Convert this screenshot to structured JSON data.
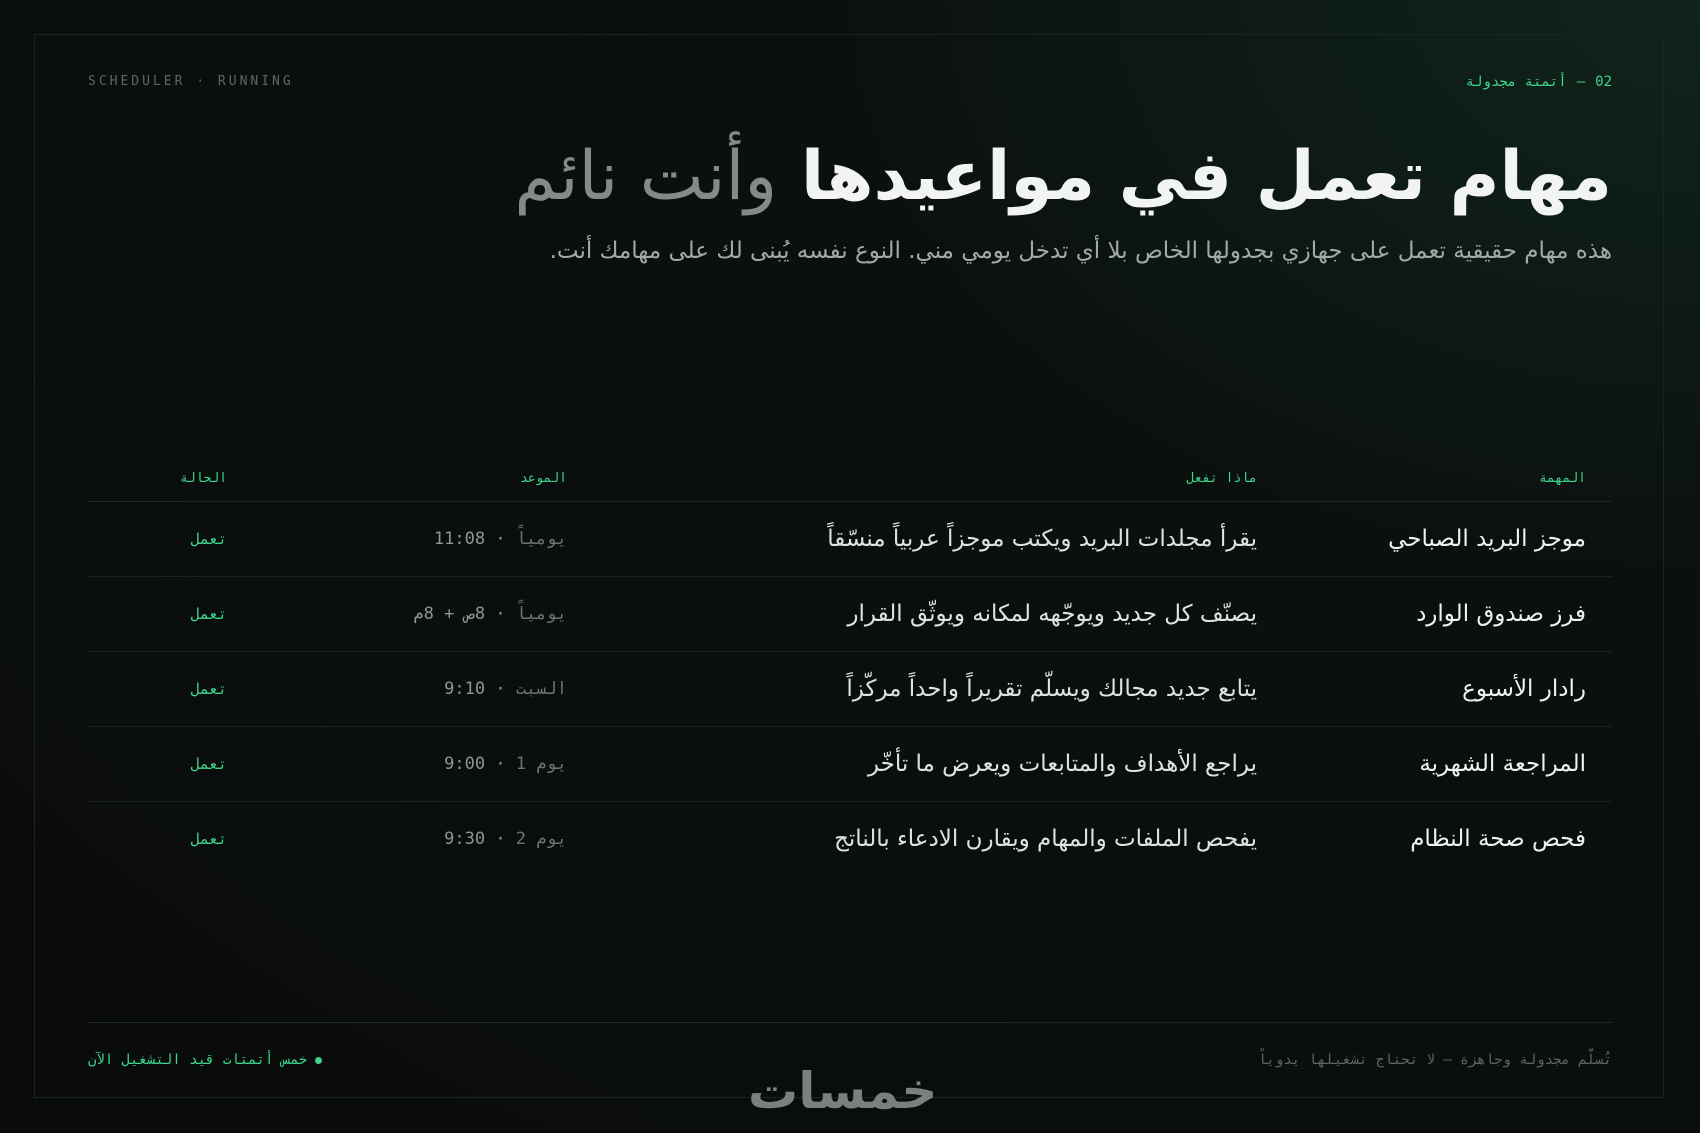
{
  "header": {
    "status": "SCHEDULER · RUNNING",
    "section_number": "02",
    "section_dash": "—",
    "section_label": "أتمتة مجدولة",
    "title_strong": "مهام تعمل في مواعيدها",
    "title_soft": "وأنت نائم",
    "subtitle": "هذه مهام حقيقية تعمل على جهازي بجدولها الخاص بلا أي تدخل يومي مني. النوع نفسه يُبنى لك على مهامك أنت."
  },
  "table": {
    "headers": {
      "task": "المهمة",
      "description": "ماذا تفعل",
      "schedule": "الموعد",
      "status": "الحالة"
    },
    "rows": [
      {
        "task": "موجز البريد الصباحي",
        "description": "يقرأ مجلدات البريد ويكتب موجزاً عربياً منسّقاً",
        "schedule_day": "يومياً",
        "schedule_time": "11:08",
        "status": "تعمل"
      },
      {
        "task": "فرز صندوق الوارد",
        "description": "يصنّف كل جديد ويوجّهه لمكانه ويوثّق القرار",
        "schedule_day": "يومياً",
        "schedule_time": "8ص + 8م",
        "status": "تعمل"
      },
      {
        "task": "رادار الأسبوع",
        "description": "يتابع جديد مجالك ويسلّم تقريراً واحداً مركّزاً",
        "schedule_day": "السبت",
        "schedule_time": "9:10",
        "status": "تعمل"
      },
      {
        "task": "المراجعة الشهرية",
        "description": "يراجع الأهداف والمتابعات ويعرض ما تأخّر",
        "schedule_day": "يوم 1",
        "schedule_time": "9:00",
        "status": "تعمل"
      },
      {
        "task": "فحص صحة النظام",
        "description": "يفحص الملفات والمهام ويقارن الادعاء بالناتج",
        "schedule_day": "يوم 2",
        "schedule_time": "9:30",
        "status": "تعمل"
      }
    ]
  },
  "footer": {
    "running_count": "خمس أتمتات قيد التشغيل الآن",
    "note": "تُسلَّم مجدولة وجاهزة — لا تحتاج تشغيلها يدوياً",
    "logo_text": "خمسات"
  },
  "colors": {
    "accent": "#3dd68c",
    "background": "#0a0c0c"
  }
}
